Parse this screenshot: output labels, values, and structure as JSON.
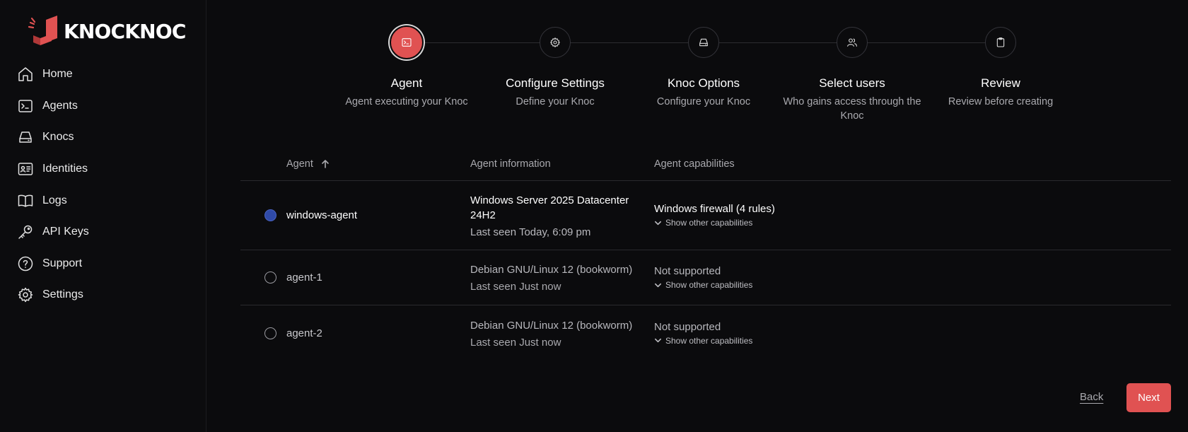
{
  "brand": {
    "name": "KNOCKNOC",
    "accent": "#e05252"
  },
  "sidebar": {
    "items": [
      {
        "label": "Home",
        "icon": "home-icon"
      },
      {
        "label": "Agents",
        "icon": "terminal-icon"
      },
      {
        "label": "Knocs",
        "icon": "drive-icon"
      },
      {
        "label": "Identities",
        "icon": "id-card-icon"
      },
      {
        "label": "Logs",
        "icon": "book-icon"
      },
      {
        "label": "API Keys",
        "icon": "key-icon"
      },
      {
        "label": "Support",
        "icon": "help-icon"
      },
      {
        "label": "Settings",
        "icon": "gear-icon"
      }
    ]
  },
  "stepper": {
    "active_index": 0,
    "steps": [
      {
        "title": "Agent",
        "subtitle": "Agent executing your Knoc",
        "icon": "terminal-icon"
      },
      {
        "title": "Configure Settings",
        "subtitle": "Define your Knoc",
        "icon": "gear-icon"
      },
      {
        "title": "Knoc Options",
        "subtitle": "Configure your Knoc",
        "icon": "drive-icon"
      },
      {
        "title": "Select users",
        "subtitle": "Who gains access through the Knoc",
        "icon": "users-icon"
      },
      {
        "title": "Review",
        "subtitle": "Review before creating",
        "icon": "clipboard-icon"
      }
    ]
  },
  "table": {
    "columns": {
      "agent": "Agent",
      "info": "Agent information",
      "capabilities": "Agent capabilities"
    },
    "sort": {
      "column": "agent",
      "direction": "ascending"
    },
    "rows": [
      {
        "selected": true,
        "agent": "windows-agent",
        "info_title": "Windows Server 2025 Datacenter 24H2",
        "last_seen": "Last seen Today, 6:09 pm",
        "capability": "Windows firewall (4 rules)",
        "more_label": "Show other capabilities"
      },
      {
        "selected": false,
        "agent": "agent-1",
        "info_title": "Debian GNU/Linux 12 (bookworm)",
        "last_seen": "Last seen Just now",
        "capability": "Not supported",
        "more_label": "Show other capabilities"
      },
      {
        "selected": false,
        "agent": "agent-2",
        "info_title": "Debian GNU/Linux 12 (bookworm)",
        "last_seen": "Last seen Just now",
        "capability": "Not supported",
        "more_label": "Show other capabilities"
      }
    ]
  },
  "actions": {
    "back_label": "Back",
    "next_label": "Next"
  }
}
